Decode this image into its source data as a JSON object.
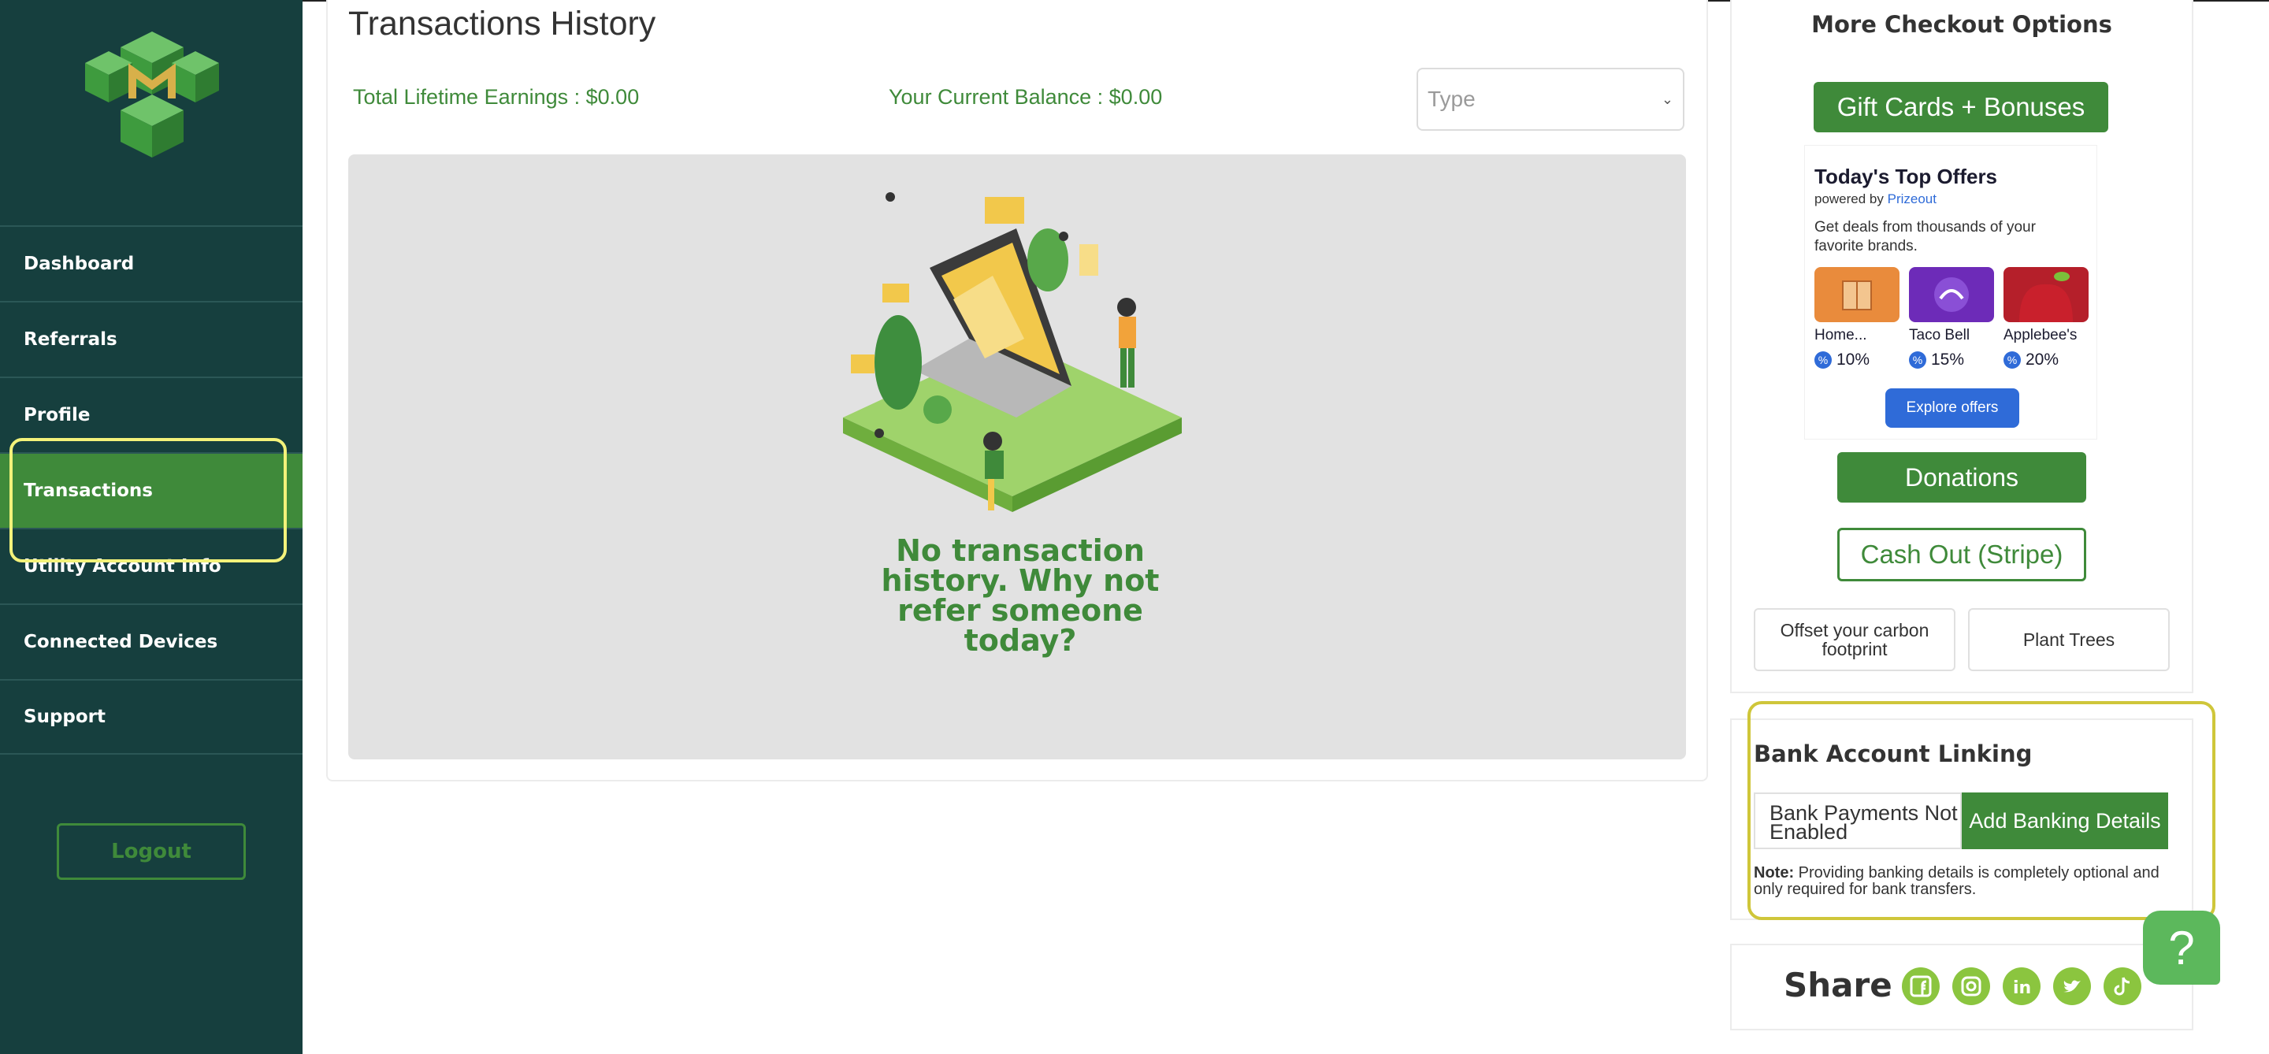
{
  "sidebar": {
    "nav": [
      {
        "label": "Dashboard"
      },
      {
        "label": "Referrals"
      },
      {
        "label": "Profile"
      },
      {
        "label": "Transactions"
      },
      {
        "label": "Utility Account Info"
      },
      {
        "label": "Connected Devices"
      },
      {
        "label": "Support"
      }
    ],
    "active": "Transactions",
    "logout_label": "Logout"
  },
  "main": {
    "title": "Transactions History",
    "lifetime_earnings": "Total Lifetime Earnings : $0.00",
    "current_balance": "Your Current Balance : $0.00",
    "type_placeholder": "Type",
    "empty_message": "No transaction history. Why not refer someone today?"
  },
  "checkout": {
    "title": "More Checkout Options",
    "gift_cards_label": "Gift Cards + Bonuses",
    "offers": {
      "heading": "Today's Top Offers",
      "powered_by": "powered by",
      "provider": "Prizeout",
      "description": "Get deals from thousands of your favorite brands.",
      "brands": [
        {
          "name": "Home...",
          "discount": "10%"
        },
        {
          "name": "Taco Bell",
          "discount": "15%"
        },
        {
          "name": "Applebee's",
          "discount": "20%"
        }
      ],
      "explore_label": "Explore offers"
    },
    "donations_label": "Donations",
    "cashout_label": "Cash Out (Stripe)",
    "offset_label": "Offset your carbon footprint",
    "plant_trees_label": "Plant Trees"
  },
  "bank": {
    "title": "Bank Account Linking",
    "status": "Bank Payments Not Enabled",
    "add_label": "Add Banking Details",
    "note_label": "Note:",
    "note_text": "Providing banking details is completely optional and only required for bank transfers."
  },
  "share": {
    "label": "Share",
    "icons": [
      "facebook-icon",
      "instagram-icon",
      "linkedin-icon",
      "twitter-icon",
      "tiktok-icon"
    ]
  },
  "help_label": "?",
  "colors": {
    "sidebar_bg": "#163f3e",
    "accent_green": "#3f8a3a",
    "highlight_yellow": "#f3f27a",
    "prizeout_blue": "#2f6bd8"
  }
}
